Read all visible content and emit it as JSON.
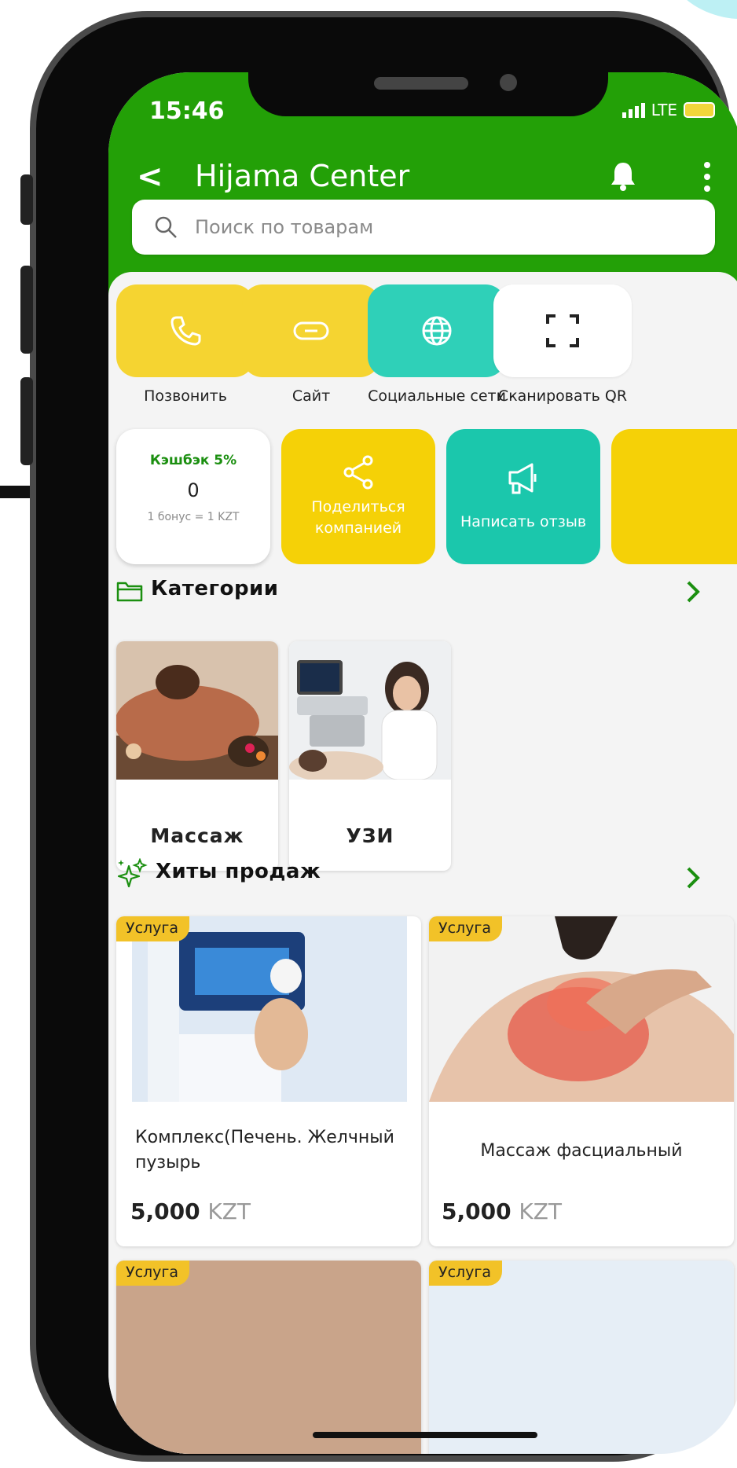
{
  "status": {
    "time": "15:46",
    "network": "LTE"
  },
  "header": {
    "back": "<",
    "title": "Hijama Center"
  },
  "search": {
    "placeholder": "Поиск по товарам"
  },
  "quick_actions": [
    {
      "label": "Позвонить",
      "icon": "phone-icon",
      "color": "#f5d431"
    },
    {
      "label": "Сайт",
      "icon": "link-icon",
      "color": "#f5d431"
    },
    {
      "label": "Социальные сети",
      "icon": "globe-icon",
      "color": "#2fd0b8"
    },
    {
      "label": "Сканировать QR",
      "icon": "scan-qr-icon",
      "color": "#ffffff"
    }
  ],
  "cashback": {
    "title": "Кэшбэк 5%",
    "value": "0",
    "note": "1 бонус = 1 KZT"
  },
  "promos": [
    {
      "label": "Поделиться компанией",
      "icon": "share-icon",
      "color": "#f5d107"
    },
    {
      "label": "Написать отзыв",
      "icon": "megaphone-icon",
      "color": "#1bc7ac"
    }
  ],
  "categories": {
    "title": "Категории",
    "items": [
      {
        "label": "Массаж"
      },
      {
        "label": "УЗИ"
      }
    ]
  },
  "hits": {
    "title": "Хиты продаж",
    "items": [
      {
        "badge": "Услуга",
        "name": "Комплекс(Печень. Желчный пузырь",
        "price": "5,000",
        "currency": "KZT"
      },
      {
        "badge": "Услуга",
        "name": "Массаж фасциальный",
        "price": "5,000",
        "currency": "KZT"
      }
    ],
    "next_badges": [
      "Услуга",
      "Услуга"
    ]
  },
  "colors": {
    "accent_green": "#23a007",
    "yellow": "#f5d431",
    "teal": "#2fd0b8"
  }
}
